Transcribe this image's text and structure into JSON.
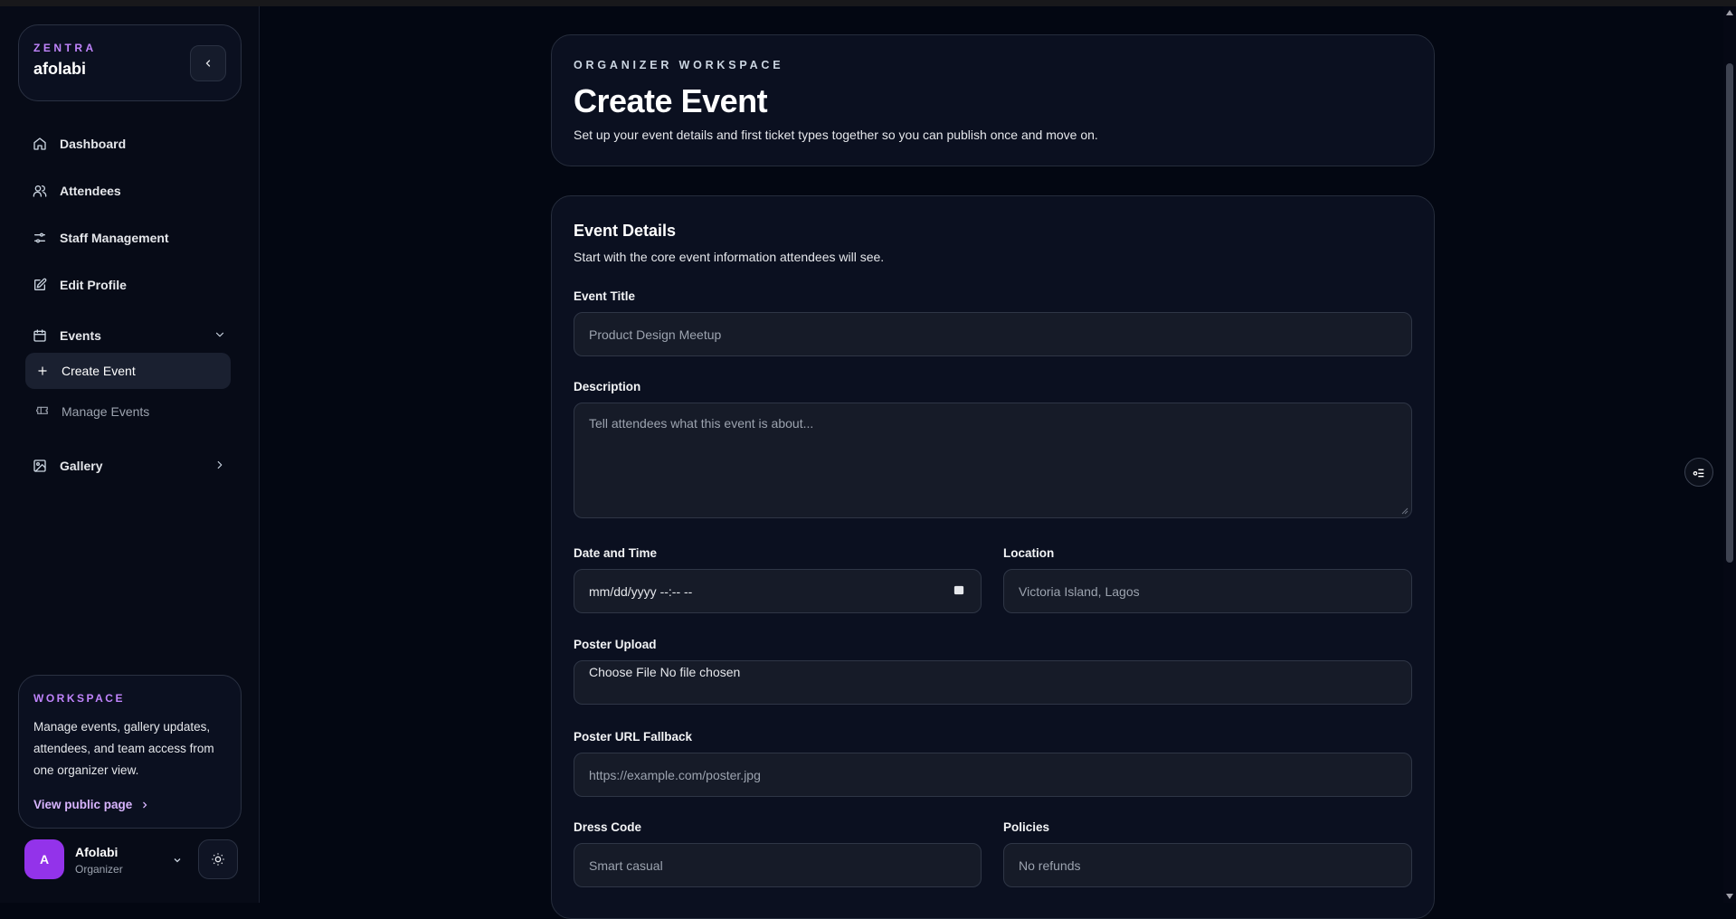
{
  "brand": {
    "kicker": "ZENTRA",
    "name": "afolabi"
  },
  "nav": {
    "dashboard": "Dashboard",
    "attendees": "Attendees",
    "staff": "Staff Management",
    "edit_profile": "Edit Profile",
    "events": "Events",
    "create_event": "Create Event",
    "manage_events": "Manage Events",
    "gallery": "Gallery"
  },
  "workspace": {
    "kicker": "WORKSPACE",
    "text": "Manage events, gallery updates, attendees, and team access from one organizer view.",
    "link": "View public page"
  },
  "user": {
    "initial": "A",
    "name": "Afolabi",
    "role": "Organizer"
  },
  "header": {
    "kicker": "ORGANIZER WORKSPACE",
    "title": "Create Event",
    "subtitle": "Set up your event details and first ticket types together so you can publish once and move on."
  },
  "form": {
    "section_title": "Event Details",
    "section_subtitle": "Start with the core event information attendees will see.",
    "event_title": {
      "label": "Event Title",
      "placeholder": "Product Design Meetup"
    },
    "description": {
      "label": "Description",
      "placeholder": "Tell attendees what this event is about..."
    },
    "date_time": {
      "label": "Date and Time",
      "value": "mm/dd/yyyy --:-- --"
    },
    "location": {
      "label": "Location",
      "placeholder": "Victoria Island, Lagos"
    },
    "poster_upload": {
      "label": "Poster Upload",
      "value": "Choose File No file chosen"
    },
    "poster_url": {
      "label": "Poster URL Fallback",
      "placeholder": "https://example.com/poster.jpg"
    },
    "dress_code": {
      "label": "Dress Code",
      "placeholder": "Smart casual"
    },
    "policies": {
      "label": "Policies",
      "placeholder": "No refunds"
    }
  },
  "colors": {
    "accent": "#c084fc",
    "avatar": "#9333ea",
    "background": "#030712",
    "card": "#0b1020"
  }
}
